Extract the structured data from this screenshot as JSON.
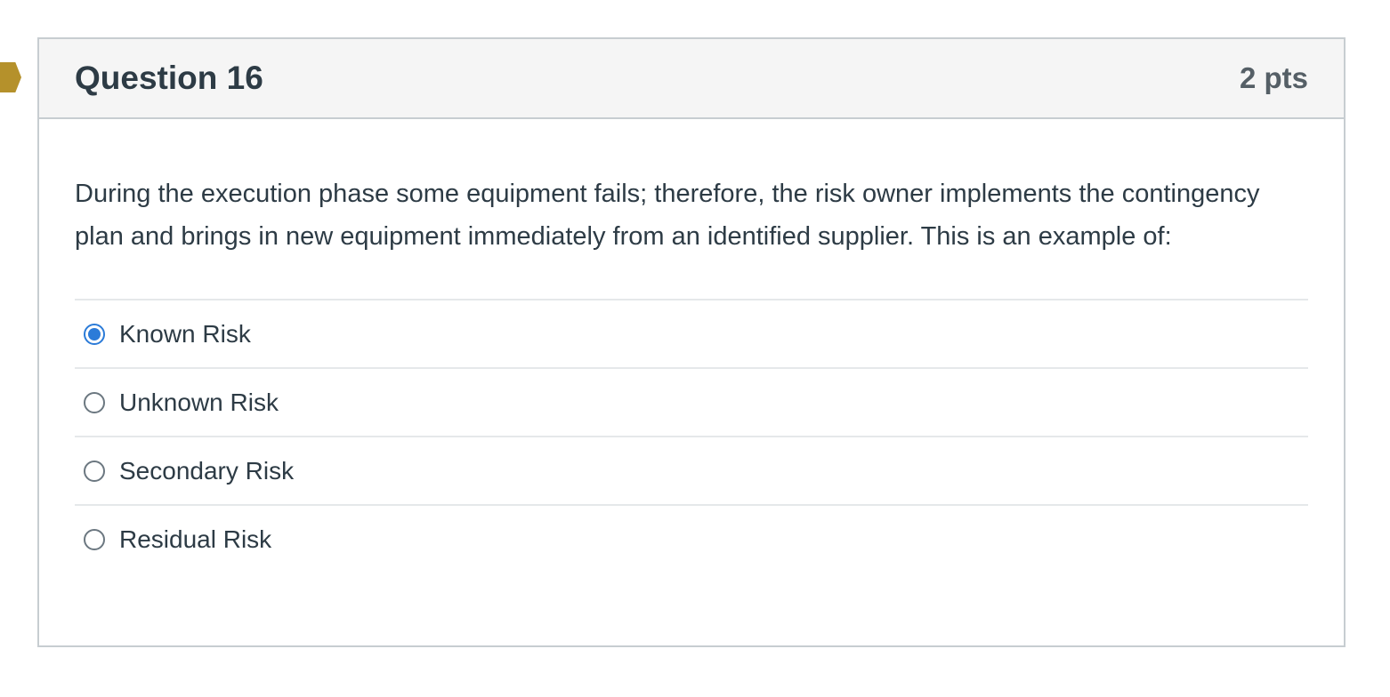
{
  "question": {
    "title": "Question 16",
    "points": "2 pts",
    "text": "During the execution phase some equipment fails; therefore, the risk owner implements the contingency plan and brings in new equipment immediately from an identified supplier. This is an example of:",
    "flag_color": "#b5912b",
    "selected_color": "#2b7bd8",
    "answers": [
      {
        "label": "Known Risk",
        "selected": true
      },
      {
        "label": "Unknown Risk",
        "selected": false
      },
      {
        "label": "Secondary Risk",
        "selected": false
      },
      {
        "label": "Residual Risk",
        "selected": false
      }
    ]
  }
}
